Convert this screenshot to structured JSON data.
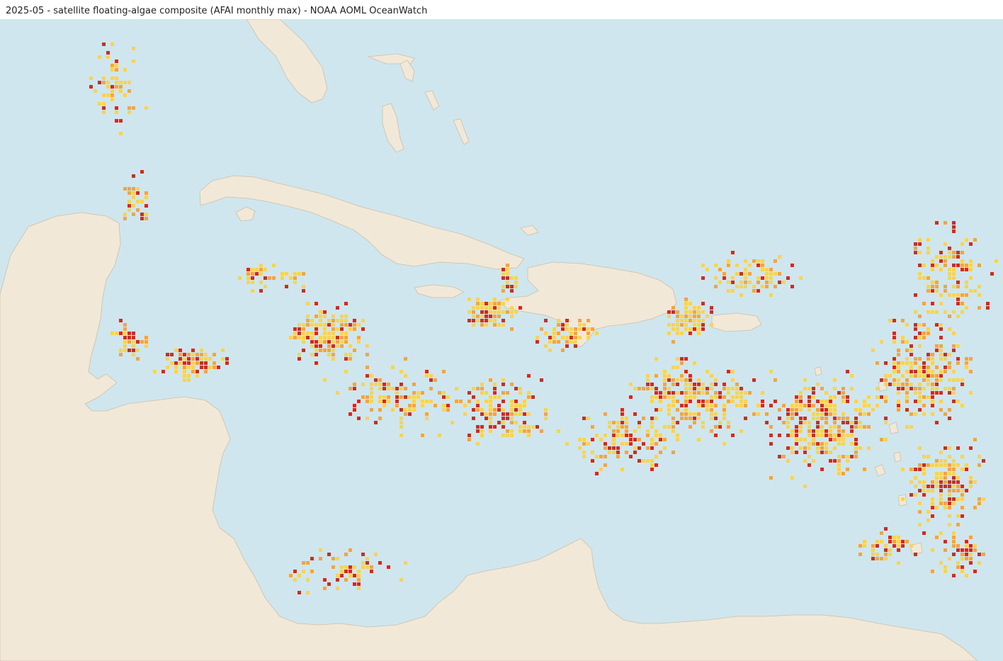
{
  "map": {
    "title": "2025-05 - satellite floating-algae composite (AFAI monthly max) - NOAA AOML OceanWatch",
    "colors": {
      "ocean": "#cfe6ee",
      "land": "#f1e8d8",
      "coast": "#cdbfa8",
      "algae_low": "#fbd448",
      "algae_mid": "#f6a43a",
      "algae_high": "#d42a1c"
    }
  }
}
